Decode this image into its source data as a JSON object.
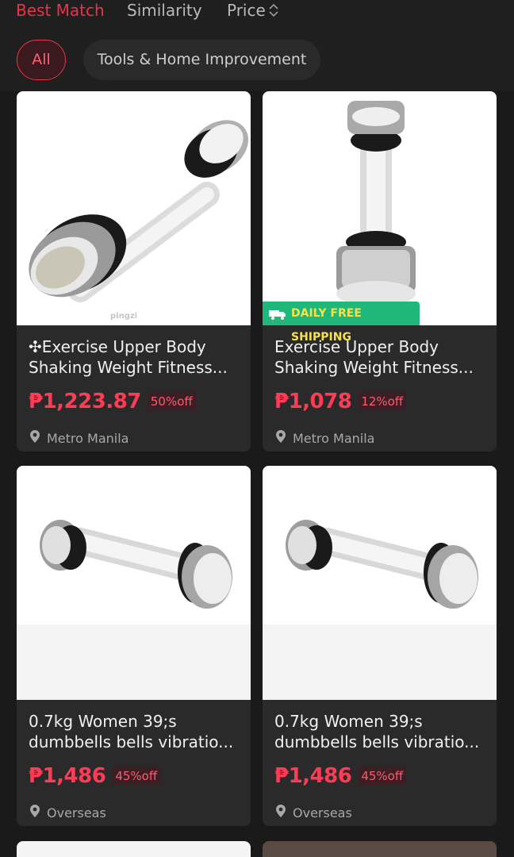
{
  "sort_bar": {
    "best_match": "Best Match",
    "similarity": "Similarity",
    "price": "Price"
  },
  "filters": {
    "all": "All",
    "tools": "Tools & Home Improvement"
  },
  "products": [
    {
      "title_line1": "✣Exercise Upper Body",
      "title_line2": "Shaking Weight Fitness...",
      "price": "₱1,223.87",
      "discount": "50%off",
      "location": "Metro Manila",
      "watermark": "pingzi"
    },
    {
      "title_line1": "Exercise Upper Body",
      "title_line2": "Shaking Weight Fitness...",
      "price": "₱1,078",
      "discount": "12%off",
      "location": "Metro Manila",
      "badge": "DAILY FREE SHIPPING"
    },
    {
      "title_line1": "0.7kg Women 39;s",
      "title_line2": "dumbbells bells vibratio...",
      "price": "₱1,486",
      "discount": "45%off",
      "location": "Overseas"
    },
    {
      "title_line1": "0.7kg Women 39;s",
      "title_line2": "dumbbells bells vibratio...",
      "price": "₱1,486",
      "discount": "45%off",
      "location": "Overseas"
    }
  ],
  "icons": {
    "price_sort": "chevron-up-down-icon",
    "location": "location-pin-icon",
    "shipping": "truck-icon"
  },
  "colors": {
    "accent": "#e8344a",
    "price": "#ff3b55",
    "shipping_badge_bg": "#1fb77a",
    "shipping_badge_text": "#f6e24a",
    "background": "#1a1a1a",
    "card": "#2a2a2a"
  }
}
